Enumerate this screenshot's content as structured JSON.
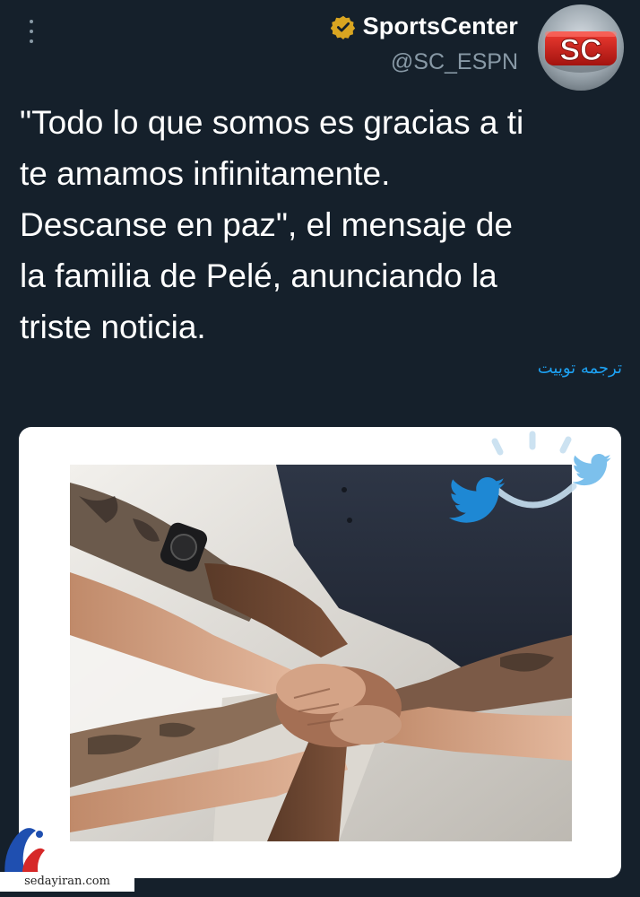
{
  "tweet": {
    "author_name": "SportsCenter",
    "author_handle": "@SC_ESPN",
    "avatar_text": "SC",
    "lines": [
      "\"Todo lo que somos es gracias a ti",
      "te amamos infinitamente.",
      "Descanse en paz\", el mensaje de",
      "la familia de Pelé, anunciando la",
      "triste noticia."
    ],
    "translate_label": "ترجمه توییت"
  },
  "icons": {
    "more": "more-vertical-icon",
    "verified": "verified-badge-icon",
    "watermark_bird": "twitter-bird-icon"
  },
  "watermark": {
    "site": "sedayiran.com"
  },
  "colors": {
    "background": "#15202b",
    "text": "#ffffff",
    "secondary": "#8899a6",
    "link": "#1da1f2",
    "verified": "#d9a521",
    "avatar_red": "#d7241f"
  }
}
